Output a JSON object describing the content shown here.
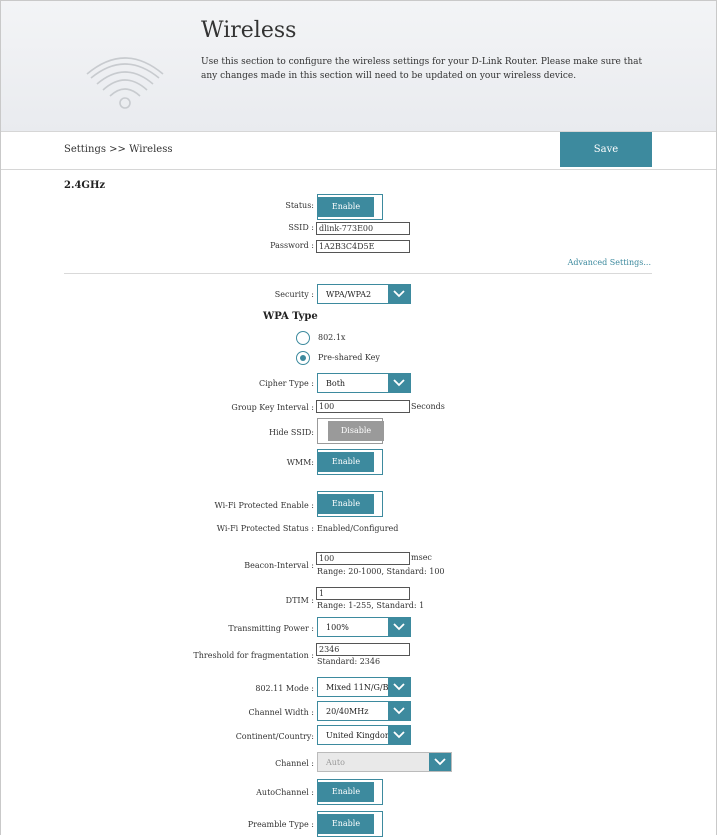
{
  "header": {
    "title": "Wireless",
    "description": "Use this section to configure the wireless settings for your D-Link Router. Please make sure that any changes made in this section will need to be updated on your wireless device.",
    "icon": "wifi-icon"
  },
  "bar": {
    "breadcrumb": "Settings >> Wireless",
    "save_label": "Save"
  },
  "band": {
    "title": "2.4GHz"
  },
  "fields": {
    "status": {
      "label": "Status:",
      "value": "Enable"
    },
    "ssid": {
      "label": "SSID :",
      "value": "dlink-773E00"
    },
    "password": {
      "label": "Password :",
      "value": "1A2B3C4D5E"
    },
    "advanced_link": "Advanced Settings...",
    "security": {
      "label": "Security :",
      "value": "WPA/WPA2"
    },
    "wpa_type": {
      "title": "WPA Type",
      "options": [
        "802.1x",
        "Pre-shared Key"
      ],
      "selected": "Pre-shared Key"
    },
    "cipher_type": {
      "label": "Cipher Type :",
      "value": "Both"
    },
    "group_key": {
      "label": "Group Key Interval :",
      "value": "100",
      "unit": "Seconds"
    },
    "hide_ssid": {
      "label": "Hide SSID:",
      "value": "Disable"
    },
    "wmm": {
      "label": "WMM:",
      "value": "Enable"
    },
    "wps_enable": {
      "label": "Wi-Fi Protected Enable :",
      "value": "Enable"
    },
    "wps_status": {
      "label": "Wi-Fi Protected Status :",
      "value": "Enabled/Configured"
    },
    "beacon": {
      "label": "Beacon-Interval :",
      "value": "100",
      "unit": "msec",
      "note": "Range: 20-1000, Standard: 100"
    },
    "dtim": {
      "label": "DTIM :",
      "value": "1",
      "note": "Range: 1-255, Standard: 1"
    },
    "tx_power": {
      "label": "Transmitting Power :",
      "value": "100%"
    },
    "frag": {
      "label": "Threshold for fragmentation :",
      "value": "2346",
      "note": "Standard: 2346"
    },
    "mode": {
      "label": "802.11 Mode :",
      "value": "Mixed 11N/G/B"
    },
    "channel_width": {
      "label": "Channel Width :",
      "value": "20/40MHz"
    },
    "country": {
      "label": "Continent/Country:",
      "value": "United Kingdom"
    },
    "channel": {
      "label": "Channel :",
      "value": "Auto"
    },
    "auto_channel": {
      "label": "AutoChannel :",
      "value": "Enable"
    },
    "preamble": {
      "label": "Preamble Type :",
      "value": "Enable"
    }
  },
  "colors": {
    "accent": "#3d8a9e",
    "disabled": "#9a9a9a"
  }
}
